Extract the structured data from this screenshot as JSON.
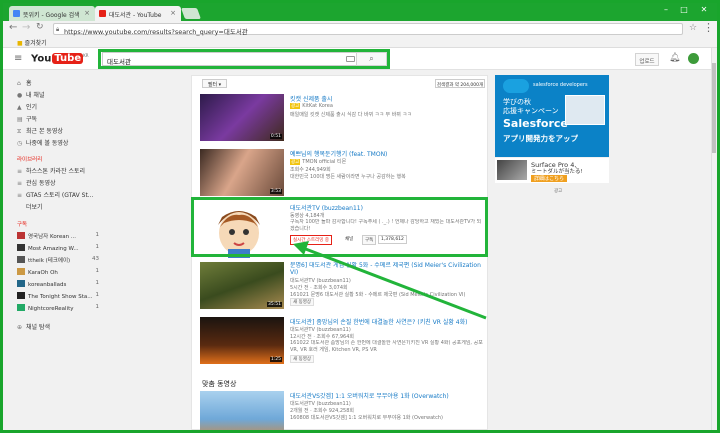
{
  "browser": {
    "tabs": [
      {
        "title": "뜻위키 - Google 검색",
        "active": false
      },
      {
        "title": "대도서관 - YouTube",
        "active": true
      }
    ],
    "url": "https://www.youtube.com/results?search_query=대도서관",
    "bookmarks_label": "즐겨찾기",
    "window_color": "#19a52c"
  },
  "header": {
    "logo_you": "You",
    "logo_tube": "Tube",
    "logo_region": "KR",
    "search_value": "대도서관",
    "upload_label": "업로드"
  },
  "sidebar": {
    "nav": [
      {
        "label": "홈",
        "icon": "home-icon"
      },
      {
        "label": "내 채널",
        "icon": "person-icon"
      },
      {
        "label": "인기",
        "icon": "fire-icon"
      },
      {
        "label": "구독",
        "icon": "subscriptions-icon"
      },
      {
        "label": "최근 본 동영상",
        "icon": "history-icon"
      },
      {
        "label": "나중에 볼 동영상",
        "icon": "clock-icon"
      }
    ],
    "library_heading": "라이브러리",
    "library": [
      {
        "label": "하스스톤 카라잔 스토리"
      },
      {
        "label": "관심 동영상"
      },
      {
        "label": "GTA5 스토리 (GTAV St..."
      },
      {
        "label": "더보기"
      }
    ],
    "subs_heading": "구독",
    "subs": [
      {
        "label": "영국남자 Korean ...",
        "count": "1",
        "color": "#b33"
      },
      {
        "label": "Most Amazing W...",
        "count": "1",
        "color": "#333"
      },
      {
        "label": "ttheik (테크에이)",
        "count": "43",
        "color": "#555"
      },
      {
        "label": "KaraOh Oh",
        "count": "1",
        "color": "#c94"
      },
      {
        "label": "koreanballads",
        "count": "1",
        "color": "#268"
      },
      {
        "label": "The Tonight Show Sta...",
        "count": "1",
        "color": "#222"
      },
      {
        "label": "NightcoreReality",
        "count": "1",
        "color": "#2a6"
      }
    ],
    "browse_channels": "채널 탐색"
  },
  "results": {
    "filter_label": "필터 ▾",
    "count_label": "검색결과 약 204,000개",
    "items": [
      {
        "title": "킷캣 신제품 출시",
        "meta1": "KitKat Korea",
        "meta2": "매일매일 킷캣 신제품 출시 식감 다 바뀌 ㅋㅋ 부 바뀌 ㅋㅋ",
        "duration": "0:51",
        "badge": "광고",
        "thumb": "#7a3aa0"
      },
      {
        "title": "예쁘님의 행복둔기행기 (feat. TMON)",
        "meta1": "TMON official 티몬",
        "meta2": "조회수 244,949회",
        "meta3": "대한민국 100대 명든 새람이라면 누구나 공감하는 행복",
        "duration": "3:53",
        "badge": "광고",
        "thumb": "#d9a58a"
      },
      {
        "title": "대도서관TV (buzzbean11)",
        "meta1": "동영상 4,184개",
        "meta2": "구독자 100만 돌파 감사합니다! 구독주세 ( ._.) ! 언제나 감당하고 재밌는 대도서관TV가 되겠습니다!",
        "live_label": "실시간 스트리밍 중",
        "channel_label": "채널",
        "subscribe_label": "구독",
        "subscribe_count": "1,378,612",
        "thumb": "#f4ead2"
      },
      {
        "title": "문명6] 대도서관 게임 실황 5화 - 수메르 제국편 (Sid Meier's Civilization VI)",
        "meta1": "대도서관TV (buzzbean11)",
        "meta2": "5시간 전 · 조회수 3,074회",
        "meta3": "161021 문명6 대도서관 실황 5화 - 수메르 제국편 (Sid Meier's Civilization VI)",
        "new_label": "새 동영상",
        "duration": "35:51",
        "thumb": "#5c6b2a"
      },
      {
        "title": "대도서관] 좀망님의 손질 한번에 대결놀한 사연은? (키친 VR 실황 4화)",
        "meta1": "대도서관TV (buzzbean11)",
        "meta2": "12시간 전 · 조회수 67,964회",
        "meta3": "161022 대도서관 좀망님의 손 한번에 대결놀한 사연은?(키친 VR 실황 4화) 공포게임, 공포 VR, VR 호러 게임, Kitchen VR, PS VR",
        "new_label": "새 동영상",
        "duration": "1:25",
        "thumb": "#2b1a12"
      }
    ],
    "related_heading": "맞춤 동영상",
    "related": [
      {
        "title": "대도서관VS갓겜] 1:1 오버워치로 무무야용 1화 (Overwatch)",
        "meta1": "대도서관TV (buzzbean11)",
        "meta2": "2개월 전 · 조회수 924,258회",
        "meta3": "160808 대도서관VS갓겜] 1:1 오버워치로 무무야용 1화 (Overwatch)",
        "duration": "",
        "thumb": "#6fa8d8"
      }
    ]
  },
  "ad": {
    "brand": "salesforce developers",
    "line1": "学びの秋",
    "line2": "応援キャンペーン",
    "line3": "Salesforce",
    "line4": "アプリ開発力をアップ",
    "surface_title": "Surface Pro 4、",
    "surface_sub": "ミートダルが当たる!",
    "surface_cta": "詳細はこちら",
    "ad_label": "광고"
  }
}
